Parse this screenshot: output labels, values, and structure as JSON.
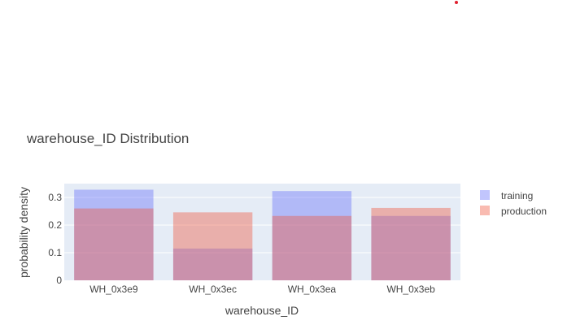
{
  "chart_data": {
    "type": "bar",
    "title": "warehouse_ID Distribution",
    "xlabel": "warehouse_ID",
    "ylabel": "probability density",
    "categories": [
      "WH_0x3e9",
      "WH_0x3ec",
      "WH_0x3ea",
      "WH_0x3eb"
    ],
    "series": [
      {
        "name": "training",
        "values": [
          0.328,
          0.115,
          0.323,
          0.233
        ],
        "color": "#636efa"
      },
      {
        "name": "production",
        "values": [
          0.26,
          0.246,
          0.233,
          0.262
        ],
        "color": "#ef553b"
      }
    ],
    "ylim": [
      0,
      0.35
    ],
    "yticks": [
      0,
      0.1,
      0.2,
      0.3
    ],
    "ytick_labels": [
      "0",
      "0.1",
      "0.2",
      "0.3"
    ],
    "barmode": "overlay",
    "opacity": 0.4,
    "grid": true,
    "plot_background": "#e5ecf6",
    "legend_position": "right"
  }
}
